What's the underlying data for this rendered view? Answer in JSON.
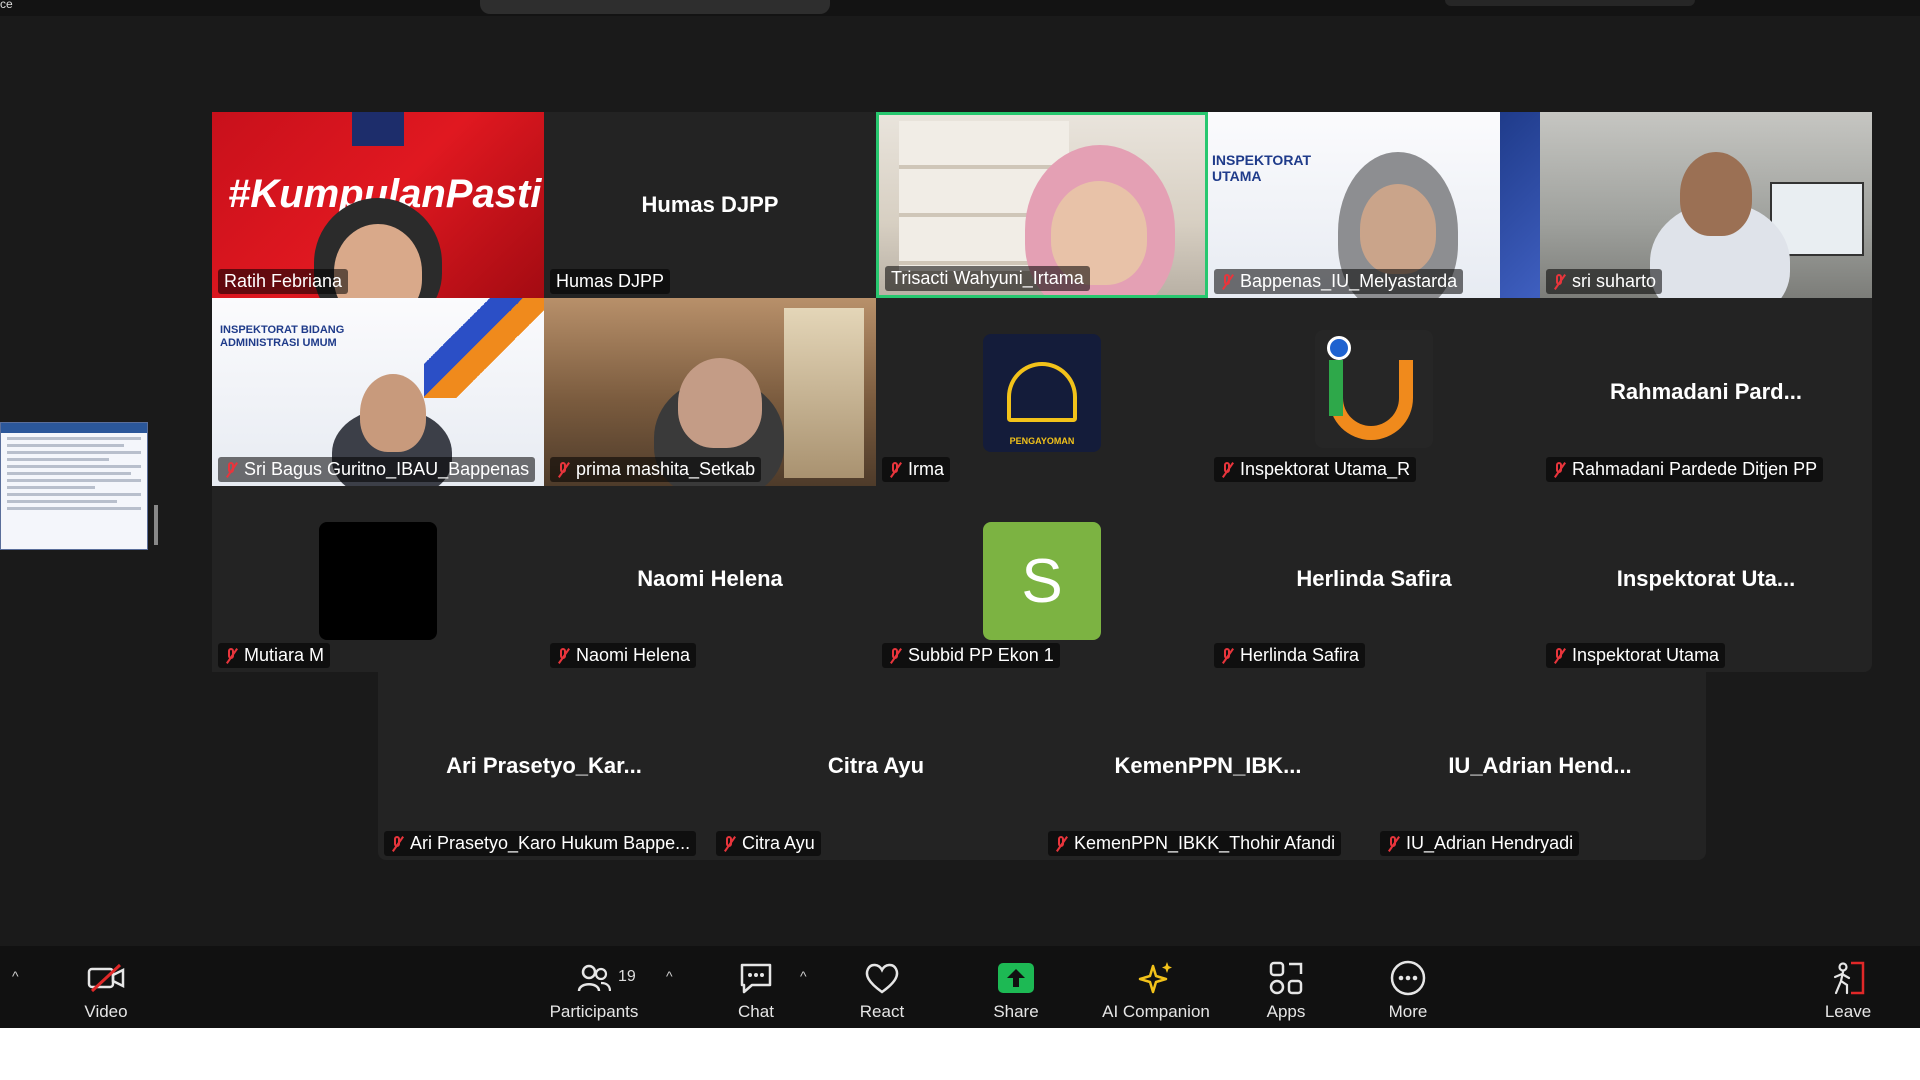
{
  "window": {
    "title_fragment": "ce"
  },
  "grid": {
    "row1": [
      {
        "name": "Ratih Febriana",
        "overlay": "#KumpulanPasti",
        "muted": false
      },
      {
        "name": "Humas DJPP",
        "center": "Humas DJPP",
        "muted": false
      },
      {
        "name": "Trisacti Wahyuni_Irtama",
        "muted": false,
        "active": true
      },
      {
        "name": "Bappenas_IU_Melyastarda",
        "overlay": "INSPEKTORAT UTAMA",
        "muted": true
      },
      {
        "name": "sri suharto",
        "muted": true
      }
    ],
    "row2": [
      {
        "name": "Sri Bagus Guritno_IBAU_Bappenas",
        "overlay": "INSPEKTORAT BIDANG ADMINISTRASI UMUM",
        "muted": true
      },
      {
        "name": "prima mashita_Setkab",
        "muted": true
      },
      {
        "name": "Irma",
        "avatar_text": "PENGAYOMAN",
        "muted": true
      },
      {
        "name": "Inspektorat Utama_R",
        "muted": true
      },
      {
        "name": "Rahmadani Pardede Ditjen PP",
        "center": "Rahmadani  Pard...",
        "muted": true
      }
    ],
    "row3": [
      {
        "name": "Mutiara M",
        "muted": true
      },
      {
        "name": "Naomi Helena",
        "center": "Naomi Helena",
        "muted": true
      },
      {
        "name": "Subbid PP Ekon 1",
        "avatar_letter": "S",
        "muted": true
      },
      {
        "name": "Herlinda Safira",
        "center": "Herlinda Safira",
        "muted": true
      },
      {
        "name": "Inspektorat Utama",
        "center": "Inspektorat  Uta...",
        "muted": true
      }
    ],
    "row4": [
      {
        "name": "Ari Prasetyo_Karo Hukum Bappe...",
        "center": "Ari  Prasetyo_Kar...",
        "muted": true
      },
      {
        "name": "Citra Ayu",
        "center": "Citra Ayu",
        "muted": true
      },
      {
        "name": "KemenPPN_IBKK_Thohir Afandi",
        "center": "KemenPPN_IBK...",
        "muted": true
      },
      {
        "name": "IU_Adrian Hendryadi",
        "center": "IU_Adrian  Hend...",
        "muted": true
      }
    ]
  },
  "toolbar": {
    "video": "Video",
    "participants": "Participants",
    "participants_count": "19",
    "chat": "Chat",
    "react": "React",
    "share": "Share",
    "ai_companion": "AI Companion",
    "apps": "Apps",
    "more": "More",
    "leave": "Leave"
  },
  "colors": {
    "active_border": "#27c76f",
    "share_green": "#1db954",
    "mute_red": "#e8353c",
    "leave_red": "#e02828",
    "avatar_green": "#7cb342"
  }
}
